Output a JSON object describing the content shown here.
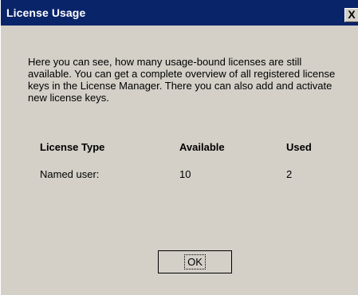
{
  "dialog": {
    "title": "License Usage",
    "close_glyph": "X",
    "description": "Here you can see, how many usage-bound licenses are still available. You can get a complete overview of all registered license keys in the License Manager. There you can also add and activate new license keys.",
    "table": {
      "headers": [
        "License Type",
        "Available",
        "Used"
      ],
      "rows": [
        [
          "Named user:",
          "10",
          "2"
        ]
      ]
    },
    "ok_label": "OK"
  },
  "colors": {
    "titlebar": "#0a246a",
    "dialog_bg": "#d4d0c8"
  }
}
